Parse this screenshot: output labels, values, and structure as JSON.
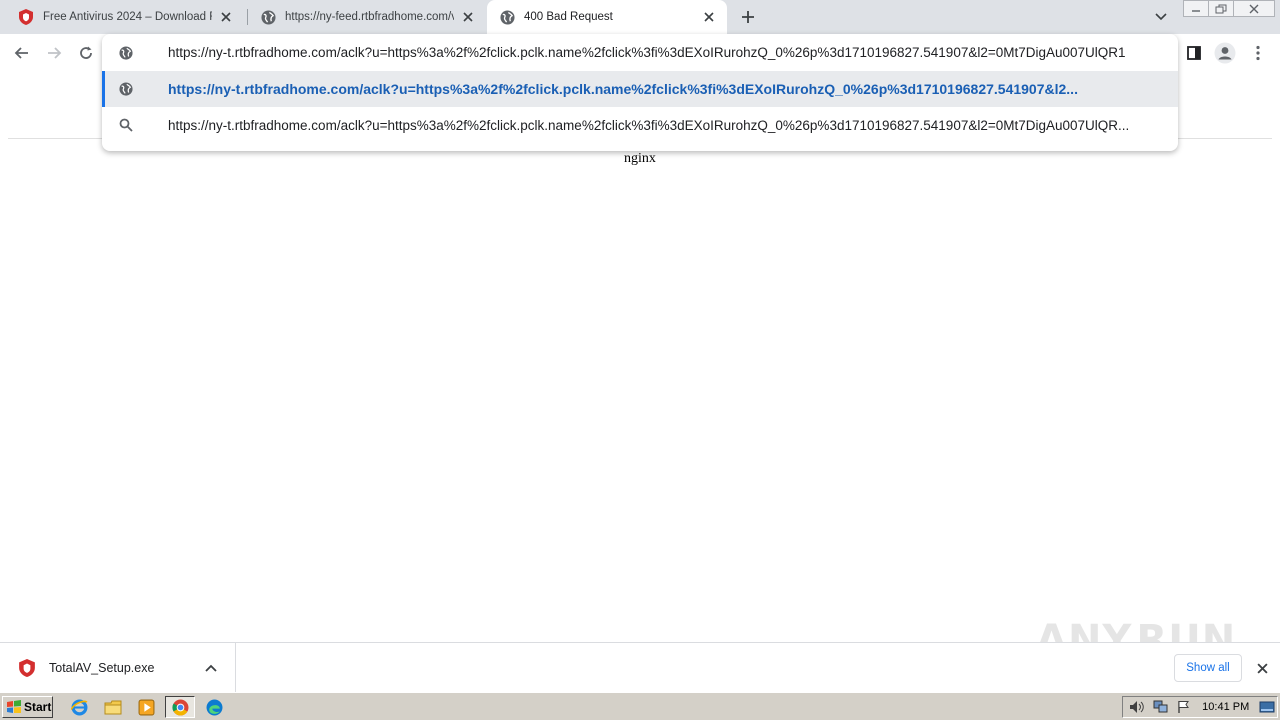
{
  "browser": {
    "tabs": [
      {
        "title": "Free Antivirus 2024 – Download Free",
        "favicon": "totalav-shield-icon"
      },
      {
        "title": "https://ny-feed.rtbfradhome.com/v",
        "favicon": "globe-icon"
      },
      {
        "title": "400 Bad Request",
        "favicon": "globe-icon",
        "active": true
      }
    ]
  },
  "omnibox": {
    "input_text": "https://ny-t.rtbfradhome.com/aclk?u=https%3a%2f%2fclick.pclk.name%2fclick%3fi%3dEXoIRurohzQ_0%26p%3d1710196827.541907&l2=0Mt7DigAu007UlQR1",
    "suggestions": [
      {
        "text": "https://ny-t.rtbfradhome.com/aclk?u=https%3a%2f%2fclick.pclk.name%2fclick%3fi%3dEXoIRurohzQ_0%26p%3d1710196827.541907&l2...",
        "icon": "globe-icon",
        "selected": true
      },
      {
        "text": "https://ny-t.rtbfradhome.com/aclk?u=https%3a%2f%2fclick.pclk.name%2fclick%3fi%3dEXoIRurohzQ_0%26p%3d1710196827.541907&l2=0Mt7DigAu007UlQR...",
        "icon": "search-icon",
        "selected": false
      }
    ]
  },
  "page": {
    "server": "nginx"
  },
  "download_bar": {
    "file_name": "TotalAV_Setup.exe",
    "show_all_label": "Show all"
  },
  "watermark": {
    "left": "ANY",
    "right": "RUN"
  },
  "taskbar": {
    "start_label": "Start",
    "clock": "10:41 PM"
  },
  "colors": {
    "accent": "#1a73e8",
    "link": "#1a5fb4",
    "shield_red": "#d32f2f"
  }
}
